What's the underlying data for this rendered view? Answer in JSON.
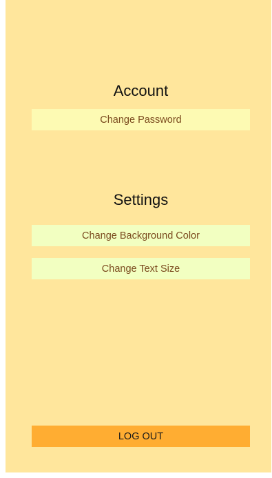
{
  "account": {
    "title": "Account",
    "change_password_label": "Change Password"
  },
  "settings": {
    "title": "Settings",
    "change_background_color_label": "Change Background Color",
    "change_text_size_label": "Change Text Size"
  },
  "footer": {
    "logout_label": "LOG OUT"
  },
  "colors": {
    "background": "#ffe69c",
    "account_button": "#fdfab3",
    "settings_button": "#f2ffc1",
    "logout_button": "#ffad32",
    "button_text": "#7a4a1e"
  }
}
